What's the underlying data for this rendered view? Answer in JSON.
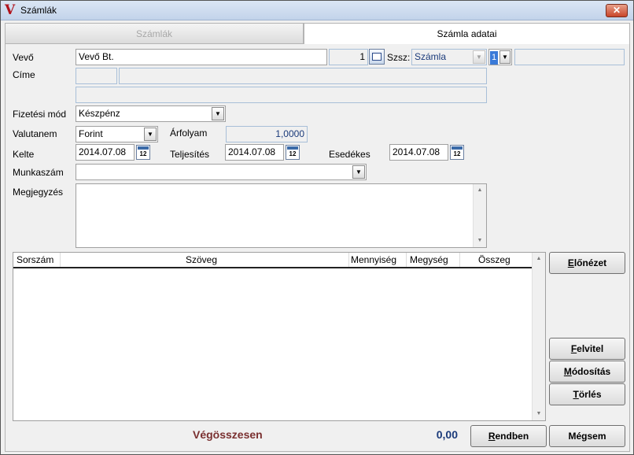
{
  "window": {
    "title": "Számlák",
    "close_glyph": "✕",
    "app_icon": "app-logo-icon"
  },
  "tabs": [
    {
      "label": "Számlák",
      "active": false
    },
    {
      "label": "Számla adatai",
      "active": true
    }
  ],
  "form": {
    "vevo_label": "Vevő",
    "vevo_value": "Vevő Bt.",
    "vevo_number": "1",
    "szsz_label": "Szsz:",
    "szsz_value": "Számla",
    "szsz_num": "1",
    "cime_label": "Címe",
    "fizetesi_mod_label": "Fizetési mód",
    "fizetesi_mod_value": "Készpénz",
    "valutanem_label": "Valutanem",
    "valutanem_value": "Forint",
    "arfolyam_label": "Árfolyam",
    "arfolyam_value": "1,0000",
    "kelte_label": "Kelte",
    "kelte_value": "2014.07.08",
    "teljesites_label": "Teljesítés",
    "teljesites_value": "2014.07.08",
    "esedekes_label": "Esedékes",
    "esedekes_value": "2014.07.08",
    "munkaszam_label": "Munkaszám",
    "munkaszam_value": "",
    "megjegyzes_label": "Megjegyzés",
    "calendar_day": "12"
  },
  "table": {
    "columns": [
      "Sorszám",
      "Szöveg",
      "Mennyiség",
      "Megység",
      "Összeg"
    ],
    "rows": []
  },
  "buttons": {
    "preview": {
      "hot": "E",
      "rest": "lőnézet"
    },
    "add": {
      "hot": "F",
      "rest": "elvitel"
    },
    "modify": {
      "hot": "M",
      "rest": "ódosítás"
    },
    "delete": {
      "hot": "T",
      "rest": "örlés"
    },
    "ok": {
      "hot": "R",
      "rest": "endben"
    },
    "cancel": {
      "label": "Mégsem"
    }
  },
  "totals": {
    "label": "Végösszesen",
    "value": "0,00"
  },
  "colors": {
    "total_label": "#7a3030",
    "total_value": "#1a3a7a",
    "close": "#c8452a"
  }
}
